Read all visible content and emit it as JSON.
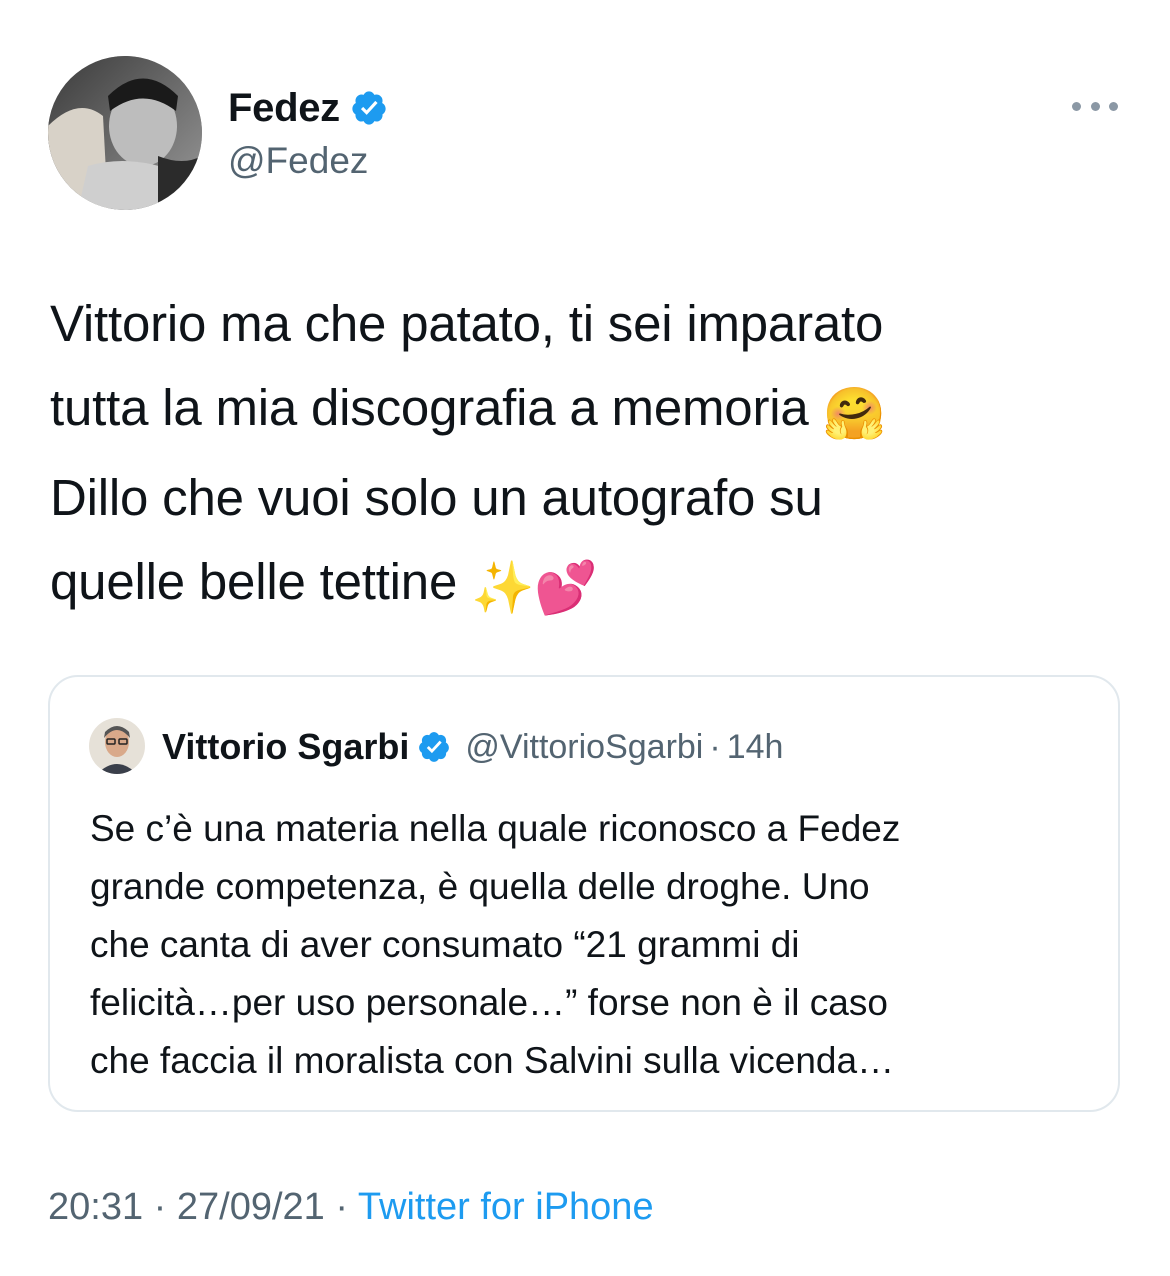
{
  "author": {
    "display_name": "Fedez",
    "handle": "@Fedez",
    "verified": true
  },
  "tweet": {
    "lines": [
      "Vittorio ma che patato, ti sei imparato",
      "tutta la mia discografia a memoria",
      "Dillo che vuoi solo un autografo su",
      "quelle belle tettine"
    ],
    "emojis": {
      "line2": "🤗",
      "line4": "✨💕"
    }
  },
  "quoted": {
    "display_name": "Vittorio Sgarbi",
    "handle": "@VittorioSgarbi",
    "separator": "·",
    "time": "14h",
    "verified": true,
    "lines": [
      "Se c’è una materia nella quale riconosco a Fedez",
      "grande competenza,  è quella delle droghe. Uno",
      "che canta di aver consumato “21 grammi di",
      "felicità…per uso personale…” forse non è il caso",
      "che faccia il moralista con Salvini sulla vicenda…"
    ]
  },
  "footer": {
    "time": "20:31",
    "sep1": " · ",
    "date": "27/09/21",
    "sep2": " · ",
    "source": "Twitter for iPhone"
  },
  "colors": {
    "accent": "#1d9bf0",
    "secondary_text": "#536471",
    "border": "#e1e8ed"
  },
  "icons": [
    "verified-badge-icon",
    "more-options-icon"
  ]
}
